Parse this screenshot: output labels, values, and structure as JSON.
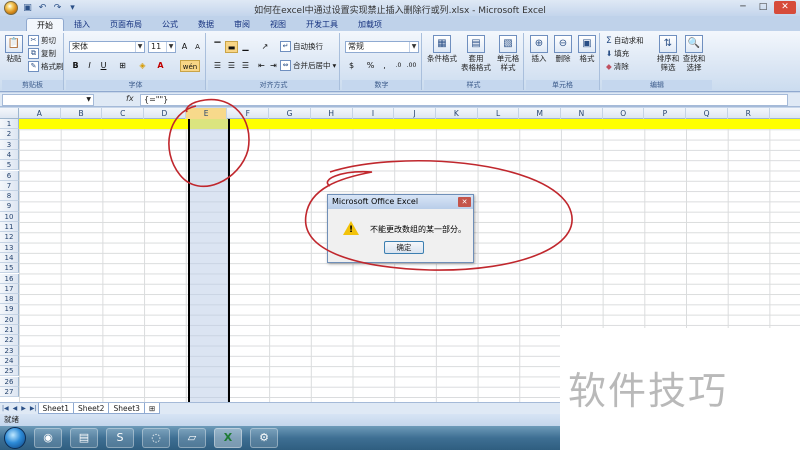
{
  "window": {
    "title": "如何在excel中通过设置实现禁止插入删除行或列.xlsx - Microsoft Excel",
    "minimize": "─",
    "maximize": "□",
    "close": "✕"
  },
  "tabs": [
    "开始",
    "插入",
    "页面布局",
    "公式",
    "数据",
    "审阅",
    "视图",
    "开发工具",
    "加载项"
  ],
  "ribbon": {
    "clipboard": {
      "paste": "粘贴",
      "cut": "剪切",
      "copy": "复制",
      "format_painter": "格式刷",
      "label": "剪贴板"
    },
    "font": {
      "name": "宋体",
      "size": "11",
      "bold": "B",
      "italic": "I",
      "underline": "U",
      "grow": "A",
      "shrink": "A",
      "phonetic": "wén",
      "label": "字体"
    },
    "alignment": {
      "wrap": "自动换行",
      "merge": "合并后居中",
      "label": "对齐方式"
    },
    "number": {
      "format": "常规",
      "currency": "$",
      "percent": "%",
      "comma": ",",
      "inc_dec": ".0",
      "dec_dec": ".00",
      "label": "数字"
    },
    "styles": {
      "conditional": "条件格式",
      "table": "套用\n表格格式",
      "cell": "单元格\n样式",
      "label": "样式"
    },
    "cells": {
      "insert": "插入",
      "delete": "删除",
      "format": "格式",
      "label": "单元格"
    },
    "editing": {
      "autosum": "自动求和",
      "fill": "填充",
      "clear": "清除",
      "sort": "排序和\n筛选",
      "find": "查找和\n选择",
      "label": "编辑"
    }
  },
  "formula_bar": {
    "fx": "fx",
    "content": "{=\"\"}"
  },
  "columns": [
    "A",
    "B",
    "C",
    "D",
    "E",
    "F",
    "G",
    "H",
    "I",
    "J",
    "K",
    "L",
    "M",
    "N",
    "O",
    "P",
    "Q",
    "R"
  ],
  "rows": [
    "1",
    "2",
    "3",
    "4",
    "5",
    "6",
    "7",
    "8",
    "9",
    "10",
    "11",
    "12",
    "13",
    "14",
    "15",
    "16",
    "17",
    "18",
    "19",
    "20",
    "21",
    "22",
    "23",
    "24",
    "25",
    "26",
    "27"
  ],
  "sheets": [
    "Sheet1",
    "Sheet2",
    "Sheet3"
  ],
  "status": "就绪",
  "dialog": {
    "title": "Microsoft Office Excel",
    "message": "不能更改数组的某一部分。",
    "ok": "确定"
  },
  "watermark": "软件技巧",
  "colors": {
    "highlight_row": "#ffff00",
    "annotation": "#c0272d",
    "selection": "#bdcbe7"
  }
}
